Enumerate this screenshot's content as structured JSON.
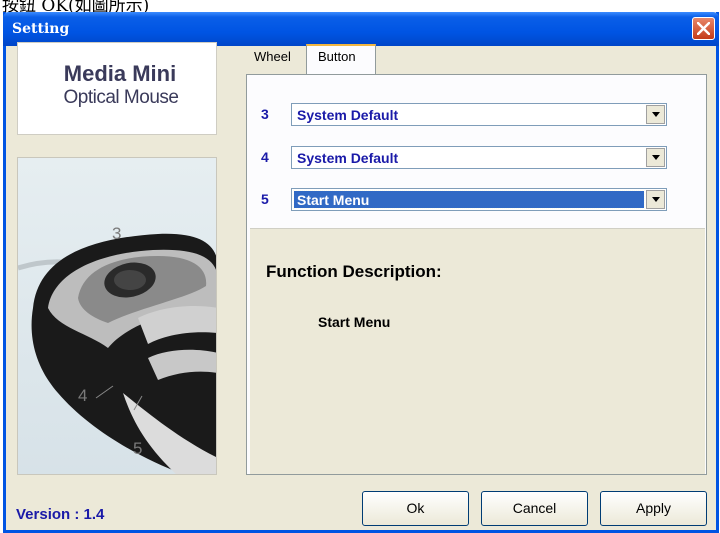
{
  "caption_fragment": "按鈕 OK(如圖所示)",
  "window": {
    "title": "Setting"
  },
  "logo": {
    "line1": "Media Mini",
    "line2": "Optical Mouse"
  },
  "mouse_labels": {
    "n3": "3",
    "n4": "4",
    "n5": "5"
  },
  "tabs": [
    {
      "label": "Wheel",
      "active": false
    },
    {
      "label": "Button",
      "active": true
    }
  ],
  "buttons_rows": [
    {
      "num": "3",
      "value": "System Default",
      "selected": false
    },
    {
      "num": "4",
      "value": "System Default",
      "selected": false
    },
    {
      "num": "5",
      "value": "Start Menu",
      "selected": true
    }
  ],
  "description": {
    "title": "Function Description:",
    "value": "Start Menu"
  },
  "version": "Version : 1.4",
  "footer": {
    "ok": "Ok",
    "cancel": "Cancel",
    "apply": "Apply"
  },
  "icons": {
    "close": "close-icon",
    "dropdown": "chevron-down-icon"
  }
}
